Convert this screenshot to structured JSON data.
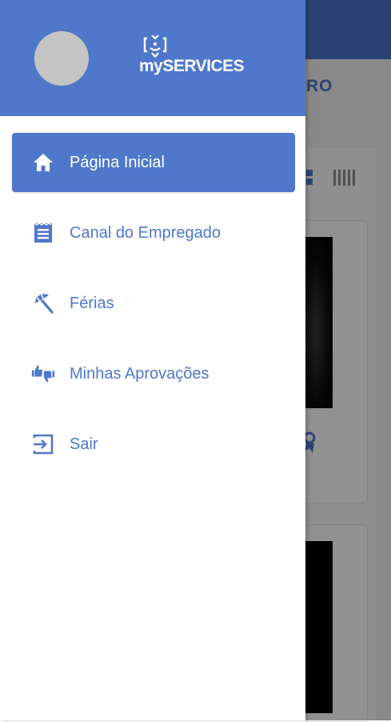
{
  "app": {
    "logo_text": "mySERVICES"
  },
  "background": {
    "header_partial_text": "RO"
  },
  "drawer": {
    "items": [
      {
        "label": "Página Inicial",
        "icon": "home-icon",
        "active": true
      },
      {
        "label": "Canal do Empregado",
        "icon": "document-icon",
        "active": false
      },
      {
        "label": "Férias",
        "icon": "beach-umbrella-icon",
        "active": false
      },
      {
        "label": "Minhas Aprovações",
        "icon": "thumbs-up-down-icon",
        "active": false
      },
      {
        "label": "Sair",
        "icon": "exit-icon",
        "active": false
      }
    ]
  },
  "colors": {
    "primary": "#4f78cb",
    "header_dark": "#4b74c9",
    "white": "#ffffff",
    "avatar_placeholder": "#c4c4c4",
    "overlay": "rgba(0,0,0,0.42)"
  }
}
